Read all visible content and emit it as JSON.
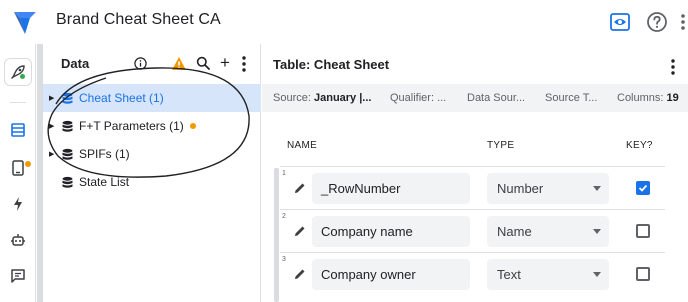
{
  "app": {
    "title": "Brand Cheat Sheet CA"
  },
  "colors": {
    "accent": "#1a73e8",
    "warning": "#f29900",
    "selected_bg": "#d7e5fa"
  },
  "rail": {
    "items": [
      {
        "icon": "rocket-icon"
      },
      {
        "icon": "data-table-icon",
        "active": true,
        "badge": true
      },
      {
        "icon": "phone-icon"
      },
      {
        "icon": "lightning-icon"
      },
      {
        "icon": "bot-icon"
      },
      {
        "icon": "chat-icon"
      }
    ]
  },
  "data_panel": {
    "title": "Data",
    "tables": [
      {
        "label": "Cheat Sheet (1)",
        "selected": true,
        "expandable": true,
        "warning_dot": false
      },
      {
        "label": "F+T Parameters (1)",
        "selected": false,
        "expandable": true,
        "warning_dot": true
      },
      {
        "label": "SPIFs (1)",
        "selected": false,
        "expandable": true,
        "warning_dot": false
      },
      {
        "label": "State List",
        "selected": false,
        "expandable": false,
        "warning_dot": false
      }
    ]
  },
  "main": {
    "title": "Table: Cheat Sheet",
    "meta": {
      "source_label": "Source:",
      "source_value": "January |...",
      "qualifier": "Qualifier: ...",
      "data_source": "Data Sour...",
      "source_type": "Source T...",
      "columns_label": "Columns:",
      "columns_value": "19"
    },
    "headers": {
      "name": "NAME",
      "type": "TYPE",
      "key": "KEY?"
    },
    "rows": [
      {
        "num": "1",
        "name": "_RowNumber",
        "type": "Number",
        "key": true
      },
      {
        "num": "2",
        "name": "Company name",
        "type": "Name",
        "key": false
      },
      {
        "num": "3",
        "name": "Company owner",
        "type": "Text",
        "key": false
      }
    ]
  }
}
